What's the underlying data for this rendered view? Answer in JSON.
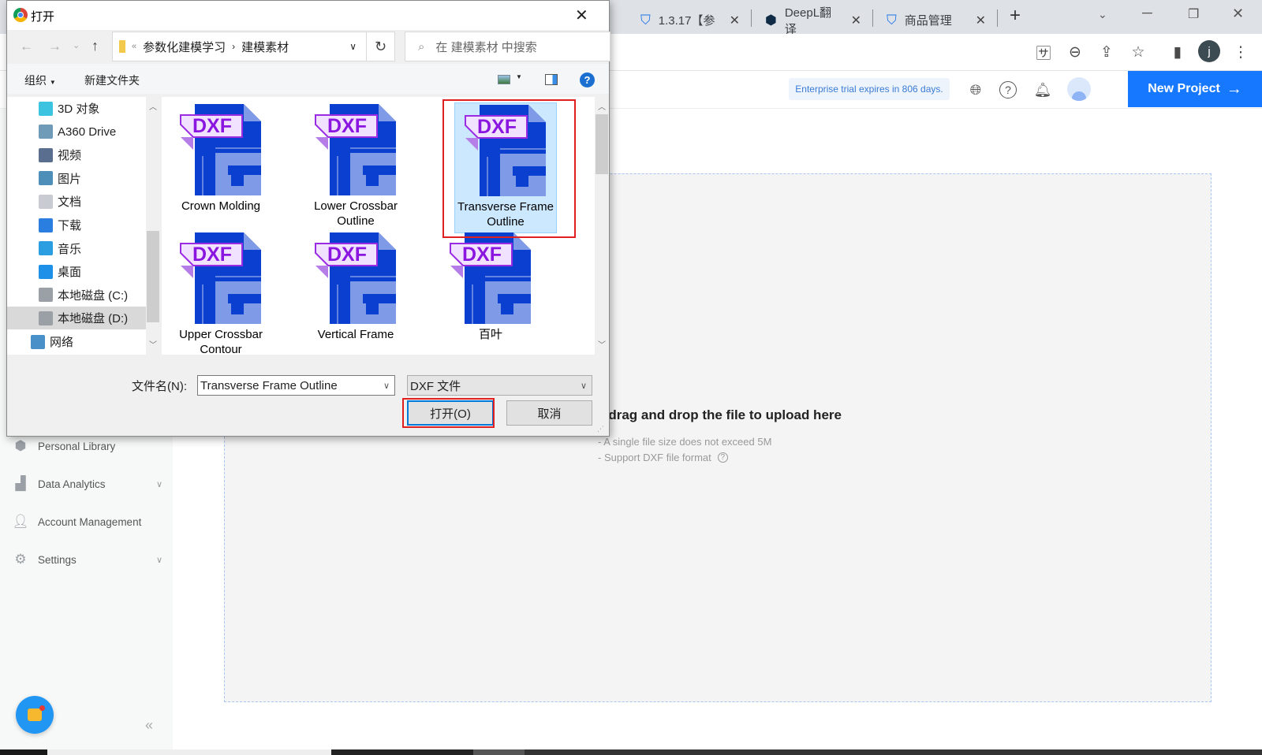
{
  "browser": {
    "tabs": [
      {
        "label": "1.3.17【参",
        "icon": "shield-smile-icon"
      },
      {
        "label": "DeepL翻译",
        "icon": "deepl-icon"
      },
      {
        "label": "商品管理",
        "icon": "shield-smile-icon"
      }
    ],
    "new_tab": "+",
    "profile_initial": "j"
  },
  "app": {
    "trial_text": "Enterprise trial expires in 806 days.",
    "new_project": "New Project",
    "accent": "#1677ff",
    "sidebar": [
      {
        "label": "Personal Library",
        "icon": "cube-icon",
        "expandable": false
      },
      {
        "label": "Data Analytics",
        "icon": "bar-chart-icon",
        "expandable": true
      },
      {
        "label": "Account Management",
        "icon": "user-icon",
        "expandable": false
      },
      {
        "label": "Settings",
        "icon": "gear-icon",
        "expandable": true
      }
    ],
    "upload": {
      "title": "r drag and drop the file to upload here",
      "hint1": "- A single file size does not exceed 5M",
      "hint2": "- Support DXF file format"
    },
    "collapse": "«"
  },
  "dialog": {
    "title": "打开",
    "breadcrumb": [
      "参数化建模学习",
      "建模素材"
    ],
    "search_placeholder": "在 建模素材 中搜索",
    "organize": "组织",
    "new_folder": "新建文件夹",
    "nav": [
      {
        "label": "3D 对象",
        "color": "#3cc3e0"
      },
      {
        "label": "A360 Drive",
        "color": "#6f9ab8"
      },
      {
        "label": "视频",
        "color": "#5a6f8f"
      },
      {
        "label": "图片",
        "color": "#4d8fb8"
      },
      {
        "label": "文档",
        "color": "#c8ccd2"
      },
      {
        "label": "下载",
        "color": "#2a7ee0"
      },
      {
        "label": "音乐",
        "color": "#2a9ee0"
      },
      {
        "label": "桌面",
        "color": "#1e90e8"
      },
      {
        "label": "本地磁盘 (C:)",
        "color": "#9aa0a6"
      },
      {
        "label": "本地磁盘 (D:)",
        "color": "#9aa0a6",
        "selected": true
      },
      {
        "label": "网络",
        "color": "#4a90c8"
      }
    ],
    "files": [
      {
        "name": "Crown Molding"
      },
      {
        "name": "Lower Crossbar Outline"
      },
      {
        "name": "Transverse Frame Outline",
        "selected": true
      },
      {
        "name": "Upper Crossbar Contour"
      },
      {
        "name": "Vertical Frame"
      },
      {
        "name": "百叶"
      }
    ],
    "file_badge": "DXF",
    "filename_label": "文件名(N):",
    "filename_value": "Transverse Frame Outline",
    "filetype_value": "DXF 文件",
    "open_label": "打开(O)",
    "cancel_label": "取消"
  }
}
